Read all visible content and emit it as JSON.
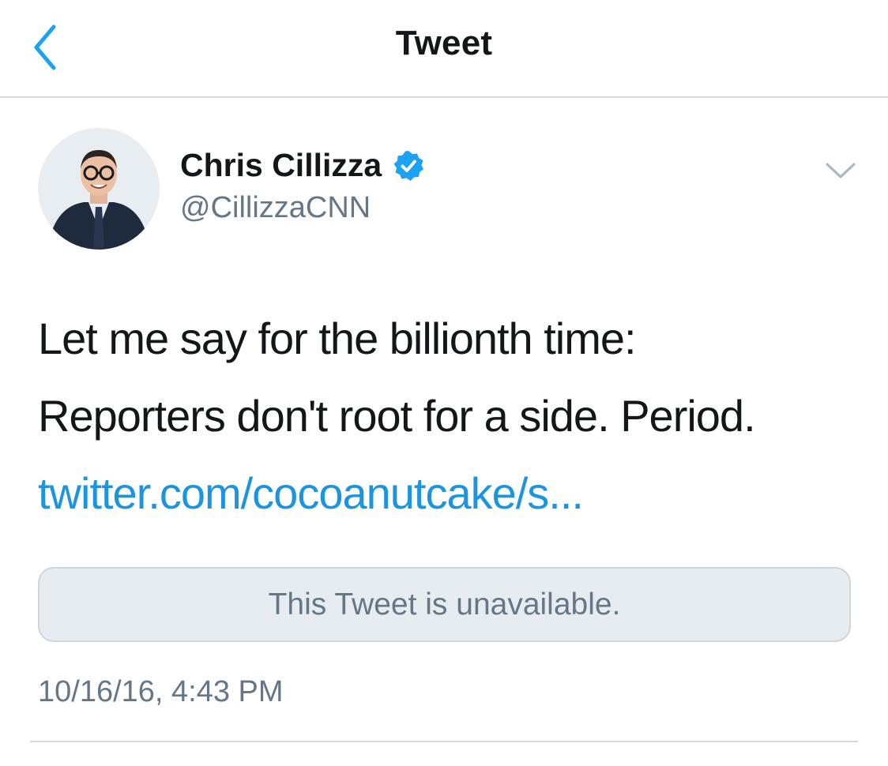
{
  "nav": {
    "title": "Tweet",
    "back_icon": "chevron-left-icon"
  },
  "author": {
    "display_name": "Chris Cillizza",
    "handle": "@CillizzaCNN",
    "verified": true
  },
  "tweet": {
    "lines": [
      "Let me say for the billionth time:",
      "Reporters don't root for a side. Period."
    ],
    "link": "twitter.com/cocoanutcake/s...",
    "quoted_status": "This Tweet is unavailable.",
    "timestamp": "10/16/16, 4:43 PM"
  },
  "colors": {
    "accent": "#1b95e0",
    "verified_badge": "#1da1f2",
    "secondary_text": "#657786",
    "quote_background": "#e6ecf0"
  }
}
